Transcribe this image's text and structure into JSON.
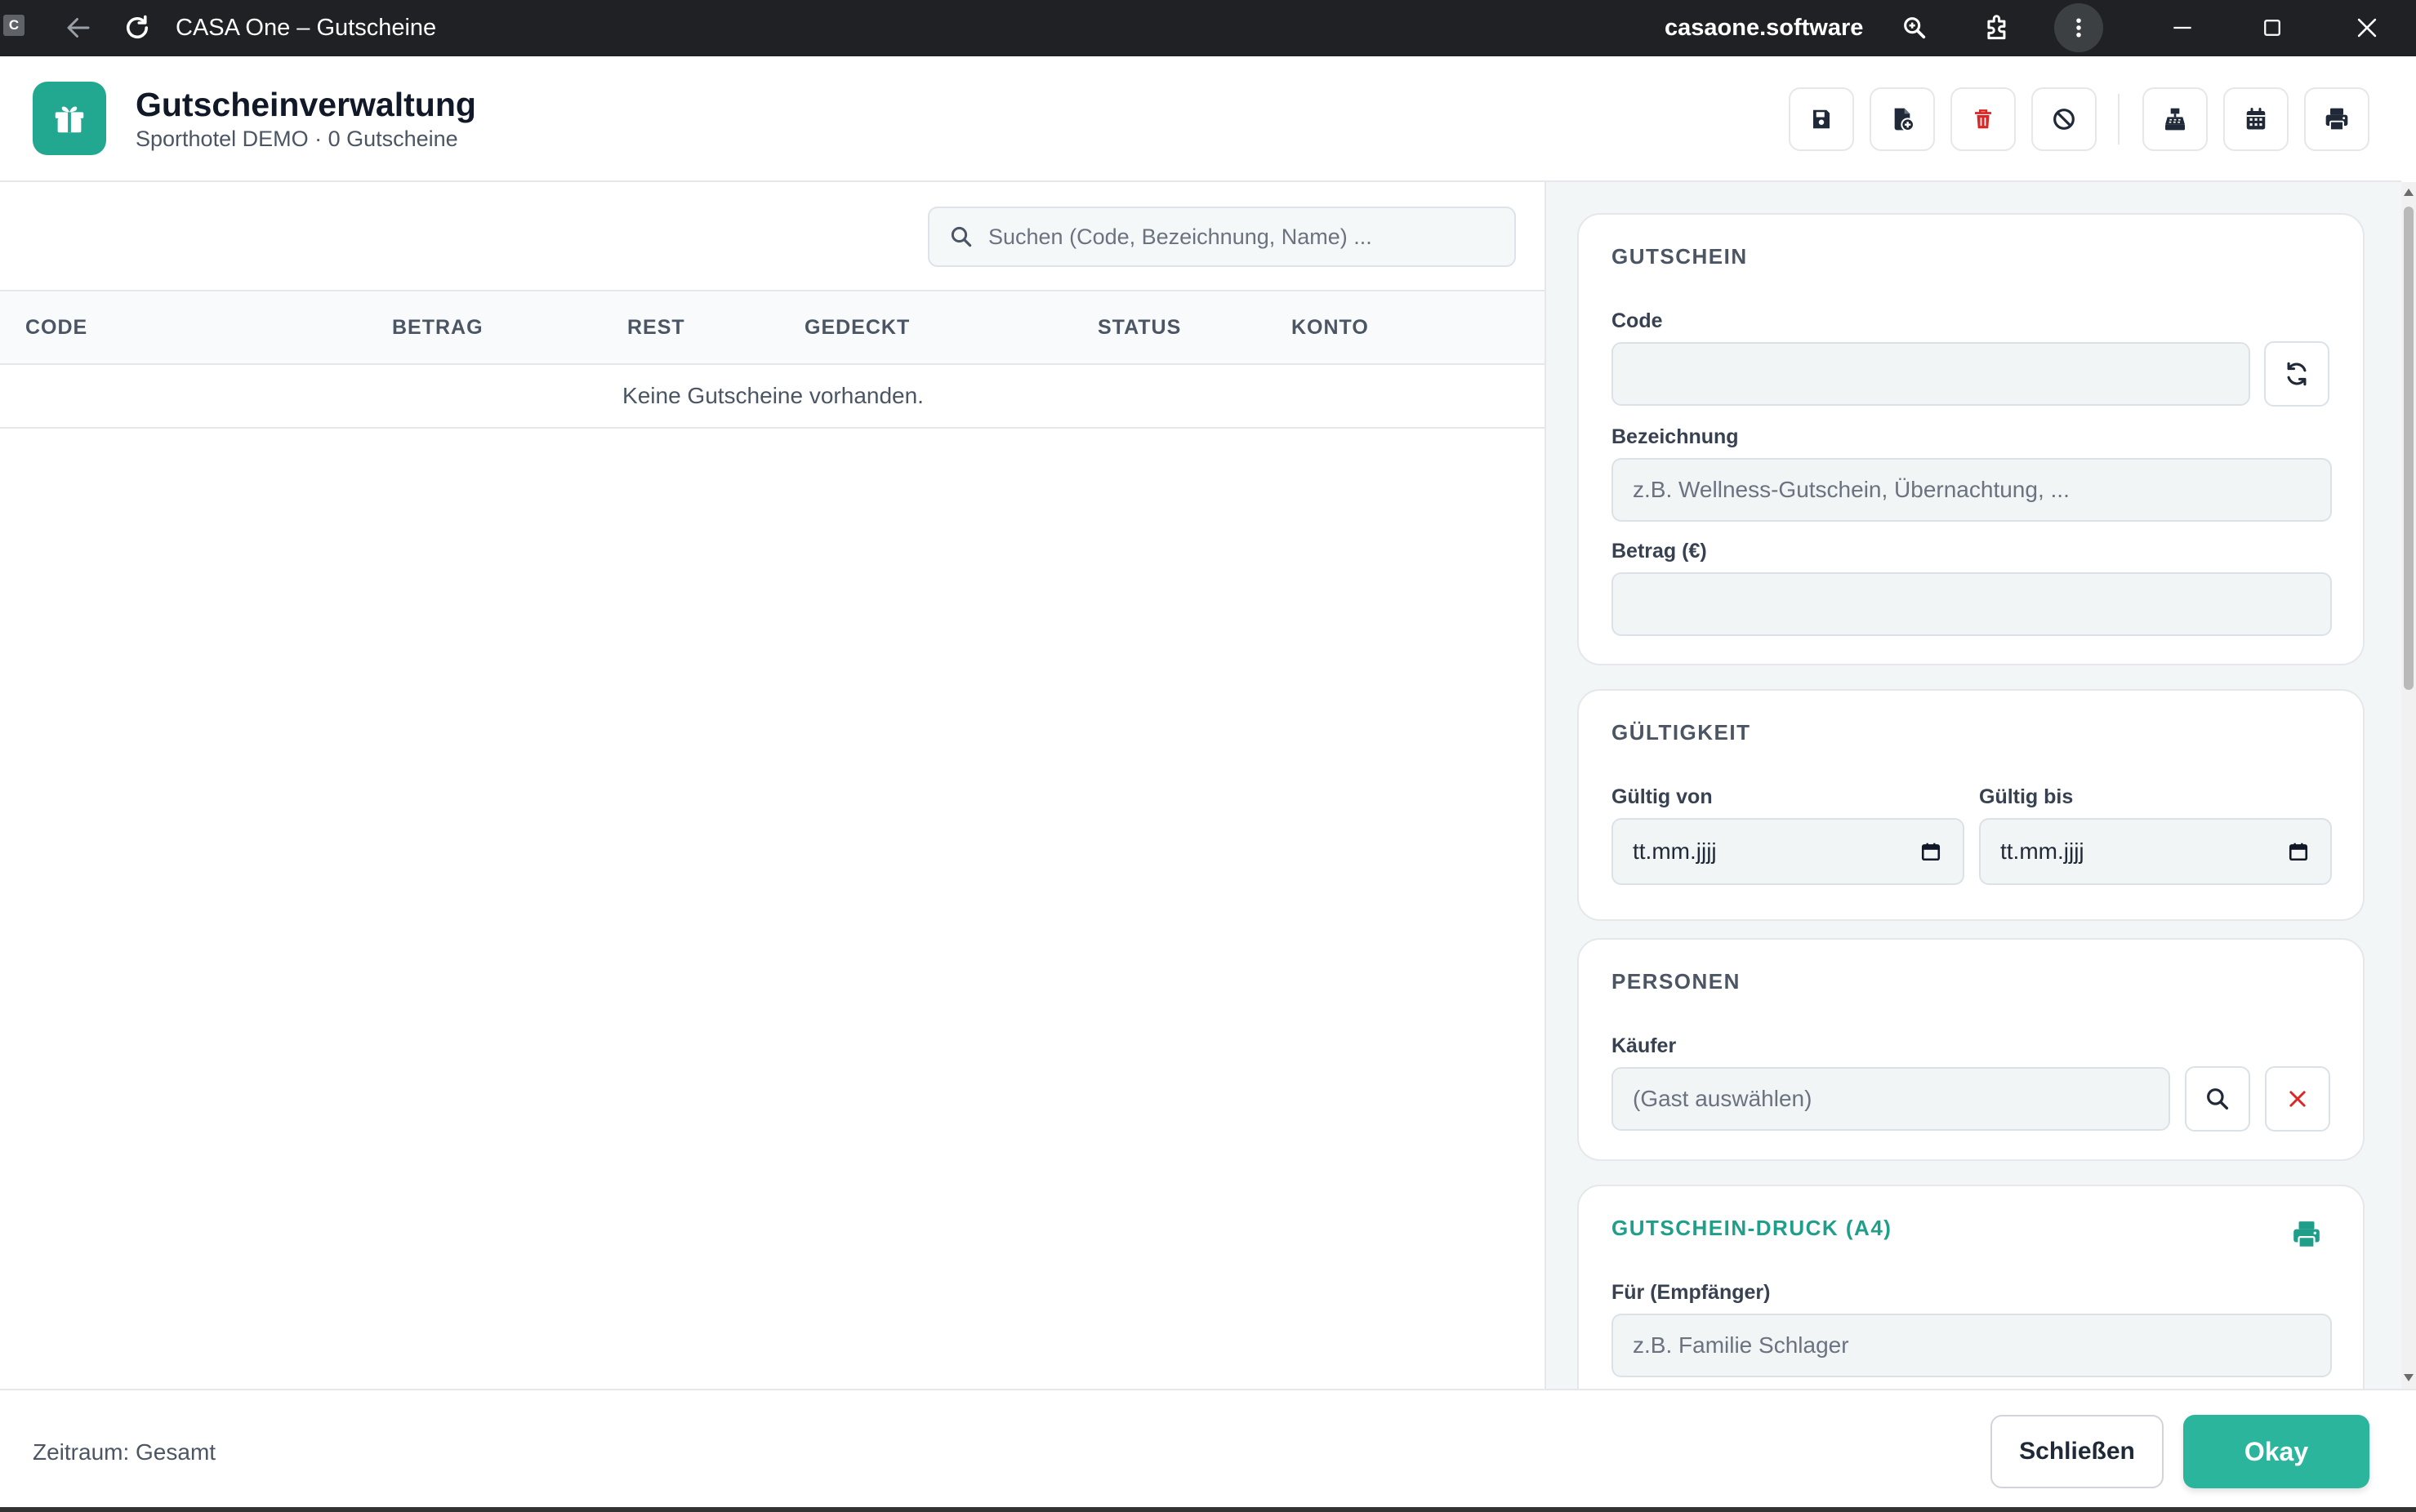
{
  "browser": {
    "favicon_letter": "C",
    "tab_title": "CASA One – Gutscheine",
    "domain": "casaone.software",
    "icons": [
      "back-arrow-icon",
      "reload-icon",
      "zoom-icon",
      "extensions-icon",
      "more-vert-icon",
      "minimize-icon",
      "maximize-icon",
      "close-icon"
    ]
  },
  "header": {
    "title": "Gutscheinverwaltung",
    "subtitle": "Sporthotel DEMO · 0 Gutscheine",
    "icon": "gift-icon",
    "toolbar_icons": [
      "save-icon",
      "new-document-icon",
      "trash-icon",
      "ban-icon",
      "cash-register-icon",
      "calendar-icon",
      "printer-icon"
    ]
  },
  "search": {
    "placeholder": "Suchen (Code, Bezeichnung, Name) ..."
  },
  "table": {
    "columns": [
      "CODE",
      "BETRAG",
      "REST",
      "GEDECKT",
      "STATUS",
      "KONTO"
    ],
    "rows": [],
    "empty_message": "Keine Gutscheine vorhanden."
  },
  "form": {
    "gutschein": {
      "title": "GUTSCHEIN",
      "code_label": "Code",
      "code_value": "",
      "bezeichnung_label": "Bezeichnung",
      "bezeichnung_placeholder": "z.B. Wellness-Gutschein, Übernachtung, ...",
      "betrag_label": "Betrag (€)",
      "betrag_value": ""
    },
    "gueltigkeit": {
      "title": "GÜLTIGKEIT",
      "von_label": "Gültig von",
      "von_value": "tt.mm.jjjj",
      "bis_label": "Gültig bis",
      "bis_value": "tt.mm.jjjj"
    },
    "personen": {
      "title": "PERSONEN",
      "kaeufer_label": "Käufer",
      "kaeufer_placeholder": "(Gast auswählen)"
    },
    "druck": {
      "title": "GUTSCHEIN-DRUCK (A4)",
      "empfaenger_label": "Für (Empfänger)",
      "empfaenger_placeholder": "z.B. Familie Schlager"
    }
  },
  "footer": {
    "zeitraum": "Zeitraum: Gesamt",
    "close_label": "Schließen",
    "ok_label": "Okay"
  },
  "colors": {
    "accent": "#2bb59d",
    "danger": "#dc2626",
    "titlebar": "#202124"
  }
}
